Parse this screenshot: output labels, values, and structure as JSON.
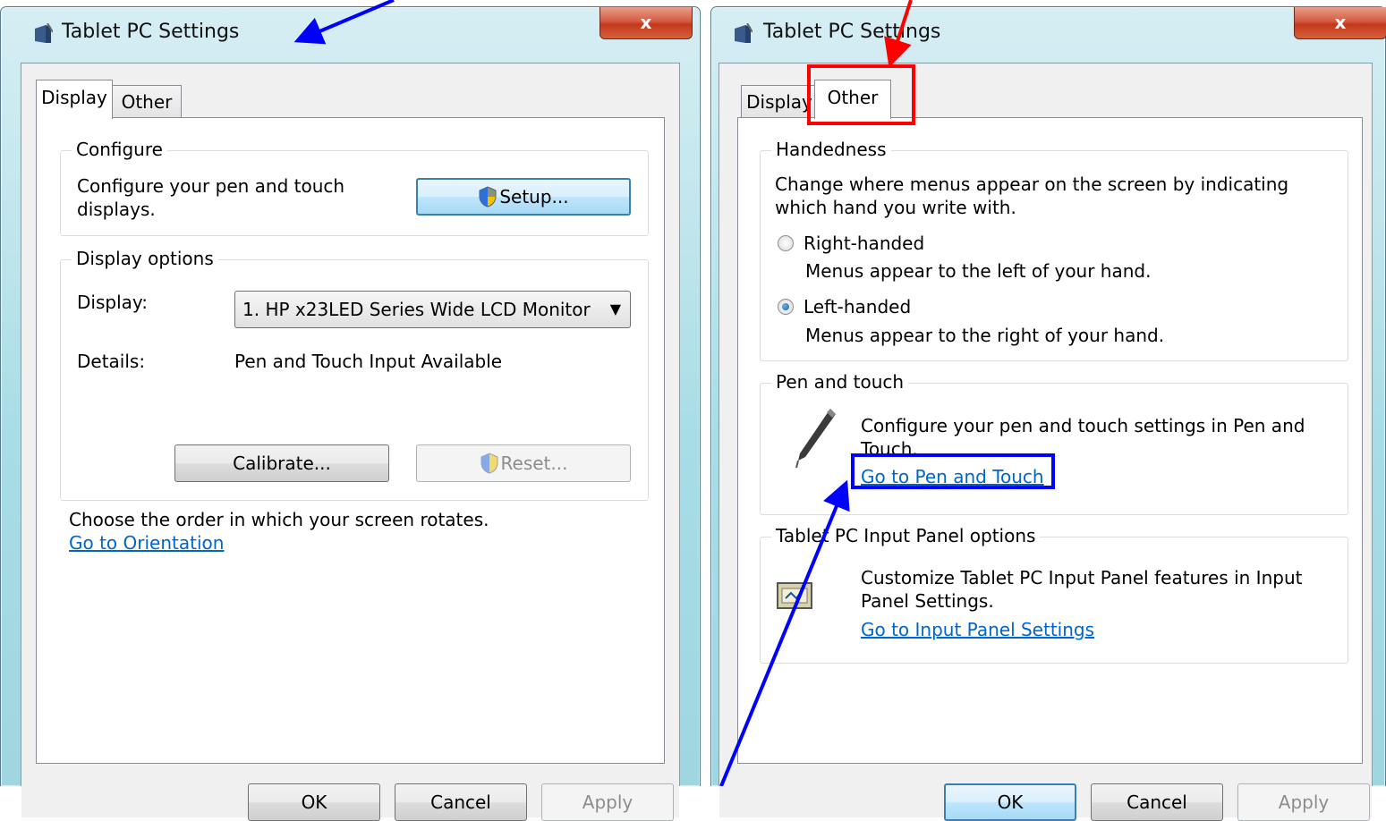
{
  "left_window": {
    "title": "Tablet PC Settings",
    "close_label": "x",
    "tabs": [
      {
        "label": "Display",
        "active": true
      },
      {
        "label": "Other",
        "active": false
      }
    ],
    "configure": {
      "legend": "Configure",
      "description": "Configure your pen and touch displays.",
      "setup_button": "Setup..."
    },
    "display_options": {
      "legend": "Display options",
      "display_label": "Display:",
      "display_value": "1. HP x23LED Series Wide LCD Monitor",
      "details_label": "Details:",
      "details_value": "Pen and Touch Input Available",
      "calibrate_button": "Calibrate...",
      "reset_button": "Reset..."
    },
    "orientation_text": "Choose the order in which your screen rotates.",
    "orientation_link": "Go to Orientation",
    "buttons": {
      "ok": "OK",
      "cancel": "Cancel",
      "apply": "Apply"
    }
  },
  "right_window": {
    "title": "Tablet PC Settings",
    "close_label": "x",
    "tabs": [
      {
        "label": "Display",
        "active": false
      },
      {
        "label": "Other",
        "active": true
      }
    ],
    "handedness": {
      "legend": "Handedness",
      "description": "Change where menus appear on the screen by indicating which hand you write with.",
      "right_label": "Right-handed",
      "right_desc": "Menus appear to the left of your hand.",
      "left_label": "Left-handed",
      "left_desc": "Menus appear to the right of your hand.",
      "selected": "Left-handed"
    },
    "pen_touch": {
      "legend": "Pen and touch",
      "description": "Configure your pen and touch settings in Pen and Touch.",
      "link": "Go to Pen and Touch"
    },
    "input_panel": {
      "legend": "Tablet PC Input Panel options",
      "description": "Customize Tablet PC Input Panel features in Input Panel Settings.",
      "link": "Go to Input Panel Settings"
    },
    "buttons": {
      "ok": "OK",
      "cancel": "Cancel",
      "apply": "Apply"
    }
  },
  "colors": {
    "annotation_blue": "#0000ff",
    "annotation_red": "#ff0000",
    "link_blue": "#0066cc"
  }
}
